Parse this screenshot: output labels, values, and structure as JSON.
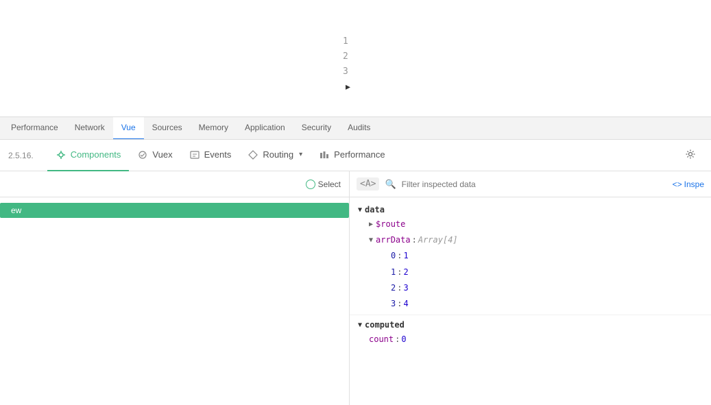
{
  "topArea": {
    "lineNumbers": [
      "1",
      "2",
      "3"
    ]
  },
  "devtoolsTabs": [
    {
      "label": "Performance",
      "active": false
    },
    {
      "label": "Network",
      "active": false
    },
    {
      "label": "Vue",
      "active": true
    },
    {
      "label": "Sources",
      "active": false
    },
    {
      "label": "Memory",
      "active": false
    },
    {
      "label": "Application",
      "active": false
    },
    {
      "label": "Security",
      "active": false
    },
    {
      "label": "Audits",
      "active": false
    }
  ],
  "vueToolbar": {
    "version": "2.5.16.",
    "buttons": [
      {
        "id": "components",
        "label": "Components",
        "active": true,
        "icon": "component-icon"
      },
      {
        "id": "vuex",
        "label": "Vuex",
        "active": false,
        "icon": "vuex-icon"
      },
      {
        "id": "events",
        "label": "Events",
        "active": false,
        "icon": "events-icon"
      },
      {
        "id": "routing",
        "label": "Routing",
        "active": false,
        "icon": "routing-icon"
      },
      {
        "id": "performance",
        "label": "Performance",
        "active": false,
        "icon": "performance-icon"
      }
    ],
    "gearIcon": "gear-icon"
  },
  "leftPane": {
    "selectLabel": "Select",
    "componentItem": "ew"
  },
  "rightPane": {
    "angleBracket": "<A>",
    "filterPlaceholder": "Filter inspected data",
    "inspectLabel": "Inspe",
    "tree": {
      "dataSectionLabel": "data",
      "routeItem": "$route",
      "arrDataLabel": "arrData",
      "arrDataType": "Array[4]",
      "arrItems": [
        {
          "index": "0",
          "value": "1"
        },
        {
          "index": "1",
          "value": "2"
        },
        {
          "index": "2",
          "value": "3"
        },
        {
          "index": "3",
          "value": "4"
        }
      ],
      "computedSectionLabel": "computed",
      "countLabel": "count",
      "countValue": "0"
    }
  }
}
